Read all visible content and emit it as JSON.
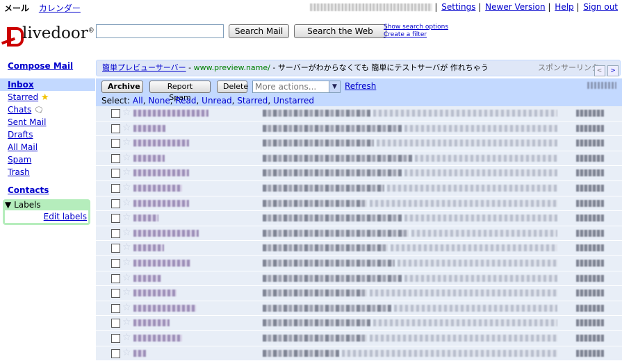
{
  "topbar": {
    "mail": "メール",
    "calendar": "カレンダー"
  },
  "toplinks": {
    "settings": "Settings",
    "newer": "Newer Version",
    "help": "Help",
    "signout": "Sign out",
    "sep": "|"
  },
  "logo": {
    "text": "livedoor",
    "mark": "®"
  },
  "search": {
    "value": "",
    "search_mail": "Search Mail",
    "search_web": "Search the Web",
    "show_options": "Show search options",
    "create_filter": "Create a filter"
  },
  "nav": {
    "compose": "Compose Mail",
    "items": [
      {
        "label": "Inbox"
      },
      {
        "label": "Starred"
      },
      {
        "label": "Chats"
      },
      {
        "label": "Sent Mail"
      },
      {
        "label": "Drafts"
      },
      {
        "label": "All Mail"
      },
      {
        "label": "Spam"
      },
      {
        "label": "Trash"
      }
    ],
    "contacts": "Contacts",
    "labels": "Labels",
    "edit_labels": "Edit labels"
  },
  "sponsor": {
    "link": "簡単プレビューサーバー",
    "dash": " - ",
    "url": "www.preview.name/",
    "desc": " - サーバーがわからなくても 簡単にテストサーバが 作れちゃう",
    "label": "スポンサーリンク",
    "prev": "<",
    "next": ">"
  },
  "toolbar": {
    "archive": "Archive",
    "report_spam": "Report Spam",
    "delete": "Delete",
    "more_actions": "More actions...",
    "refresh": "Refresh",
    "select_label": "Select:",
    "select_options": [
      "All",
      "None",
      "Read",
      "Unread",
      "Starred",
      "Unstarred"
    ]
  },
  "colors": {
    "accent": "#c3d9ff",
    "link": "#0000cc",
    "row_bg": "#e8eef7",
    "labels_bg": "#b5edbc",
    "logo_red": "#cc0000"
  }
}
